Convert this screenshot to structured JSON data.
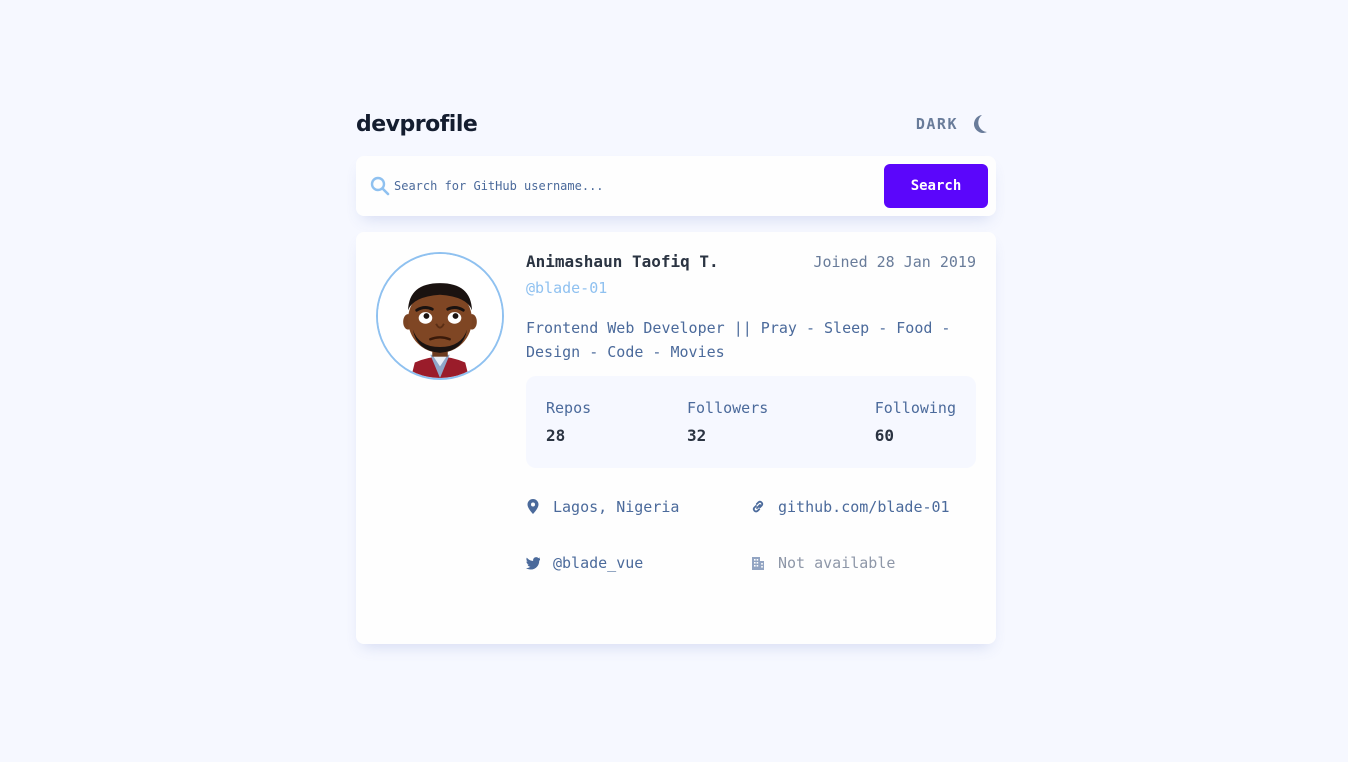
{
  "header": {
    "logo": "devprofile",
    "theme_label": "DARK",
    "theme_icon": "moon-icon"
  },
  "search": {
    "icon": "search-icon",
    "placeholder": "Search for GitHub username...",
    "value": "",
    "button_label": "Search"
  },
  "profile": {
    "avatar_icon": "avatar-image",
    "name": "Animashaun Taofiq T.",
    "joined": "Joined 28 Jan 2019",
    "handle": "@blade-01",
    "bio": "Frontend Web Developer || Pray - Sleep - Food - Design - Code - Movies",
    "stats": {
      "repos_label": "Repos",
      "repos_value": "28",
      "followers_label": "Followers",
      "followers_value": "32",
      "following_label": "Following",
      "following_value": "60"
    },
    "links": {
      "location": "Lagos, Nigeria",
      "blog": "github.com/blade-01",
      "twitter": "@blade_vue",
      "company": "Not available"
    }
  },
  "colors": {
    "background": "#f6f8ff",
    "card": "#fefefe",
    "accent": "#5b06fb",
    "handle": "#8fc1f0",
    "text": "#4b6a9b",
    "heading": "#2b3442"
  }
}
